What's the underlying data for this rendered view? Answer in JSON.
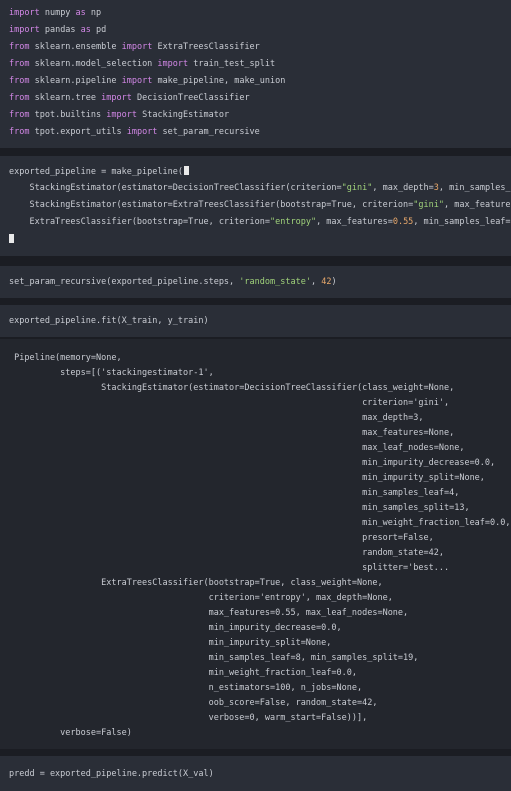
{
  "cells": {
    "imports": {
      "lines": [
        [
          "import",
          " numpy ",
          "as",
          " np"
        ],
        [
          "import",
          " pandas ",
          "as",
          " pd"
        ],
        [
          "from",
          " sklearn.ensemble ",
          "import",
          " ExtraTreesClassifier"
        ],
        [
          "from",
          " sklearn.model_selection ",
          "import",
          " train_test_split"
        ],
        [
          "from",
          " sklearn.pipeline ",
          "import",
          " make_pipeline, make_union"
        ],
        [
          "from",
          " sklearn.tree ",
          "import",
          " DecisionTreeClassifier"
        ],
        [
          "from",
          " tpot.builtins ",
          "import",
          " StackingEstimator"
        ],
        [
          "from",
          " tpot.export_utils ",
          "import",
          " set_param_recursive"
        ]
      ]
    },
    "pipeline": {
      "line1": "exported_pipeline = make_pipeline(",
      "line2a": "    StackingEstimator(estimator=DecisionTreeClassifier(criterion=",
      "line2s": "\"gini\"",
      "line2b": ", max_depth=",
      "line2n": "3",
      "line2c": ", min_samples_l",
      "line3a": "    StackingEstimator(estimator=ExtraTreesClassifier(bootstrap=True, criterion=",
      "line3s": "\"gini\"",
      "line3b": ", max_features",
      "line4a": "    ExtraTreesClassifier(bootstrap=True, criterion=",
      "line4s": "\"entropy\"",
      "line4b": ", max_features=",
      "line4n": "0.55",
      "line4c": ", min_samples_leaf=",
      "line4n2": "8",
      "line5": ")"
    },
    "set_param": {
      "a": "set_param_recursive(exported_pipeline.steps, ",
      "s": "'random_state'",
      "b": ", ",
      "n": "42",
      "c": ")"
    },
    "fit": {
      "code": "exported_pipeline.fit(X_train, y_train)"
    },
    "fit_output": {
      "lines": [
        " Pipeline(memory=None,",
        "          steps=[('stackingestimator-1',",
        "                  StackingEstimator(estimator=DecisionTreeClassifier(class_weight=None,",
        "                                                                     criterion='gini',",
        "                                                                     max_depth=3,",
        "                                                                     max_features=None,",
        "                                                                     max_leaf_nodes=None,",
        "                                                                     min_impurity_decrease=0.0,",
        "                                                                     min_impurity_split=None,",
        "                                                                     min_samples_leaf=4,",
        "                                                                     min_samples_split=13,",
        "                                                                     min_weight_fraction_leaf=0.0,",
        "                                                                     presort=False,",
        "                                                                     random_state=42,",
        "                                                                     splitter='best...",
        "                  ExtraTreesClassifier(bootstrap=True, class_weight=None,",
        "                                       criterion='entropy', max_depth=None,",
        "                                       max_features=0.55, max_leaf_nodes=None,",
        "                                       min_impurity_decrease=0.0,",
        "                                       min_impurity_split=None,",
        "                                       min_samples_leaf=8, min_samples_split=19,",
        "                                       min_weight_fraction_leaf=0.0,",
        "                                       n_estimators=100, n_jobs=None,",
        "                                       oob_score=False, random_state=42,",
        "                                       verbose=0, warm_start=False))],",
        "          verbose=False)"
      ]
    },
    "predict": {
      "code": "predd = exported_pipeline.predict(X_val)"
    }
  }
}
